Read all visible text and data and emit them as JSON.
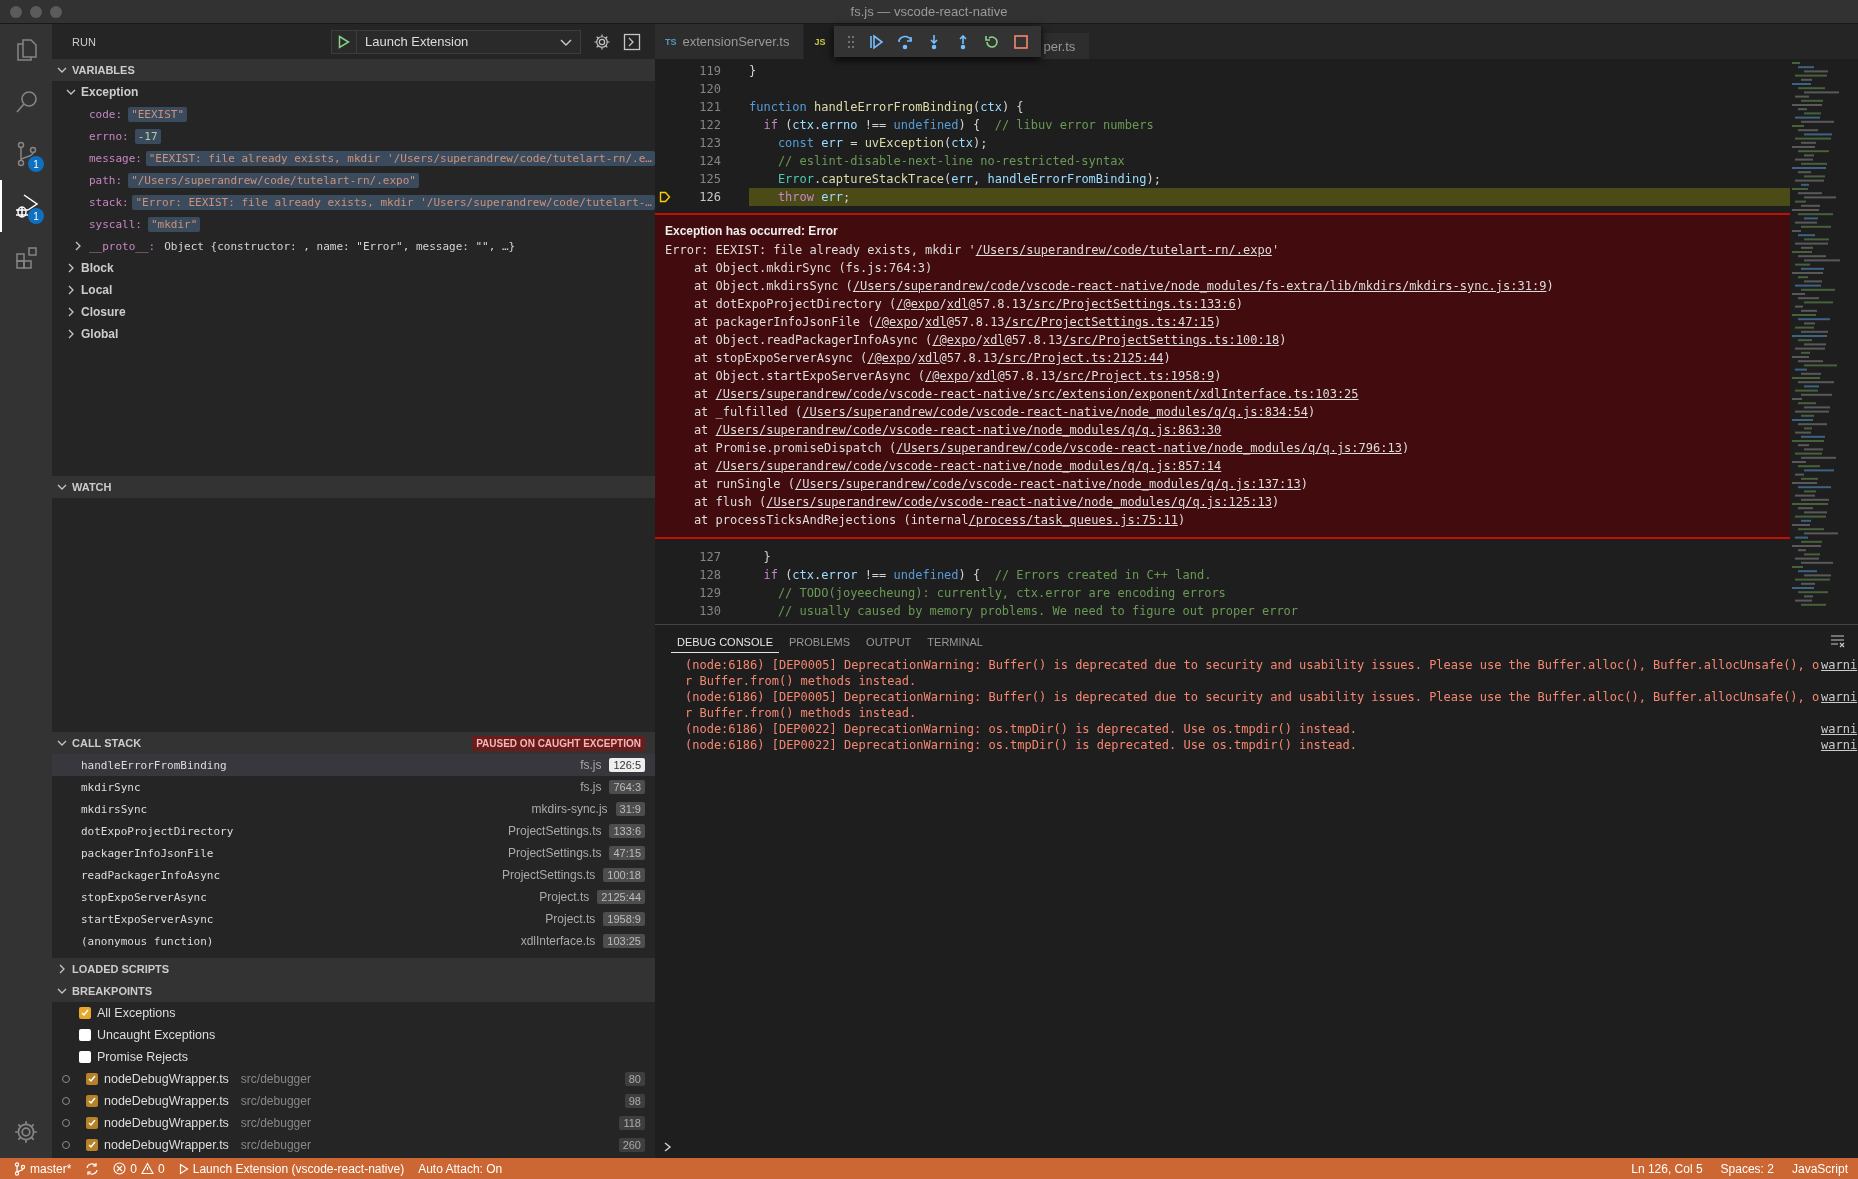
{
  "window": {
    "title": "fs.js — vscode-react-native"
  },
  "activity_bar": [
    {
      "kind": "explorer",
      "selected": false
    },
    {
      "kind": "search",
      "selected": false
    },
    {
      "kind": "source-control",
      "selected": false,
      "badge": "1"
    },
    {
      "kind": "debug",
      "selected": true,
      "badge": "1"
    },
    {
      "kind": "extensions",
      "selected": false
    }
  ],
  "sidebar": {
    "title": "RUN",
    "config": "Launch Extension"
  },
  "variables": {
    "title": "VARIABLES",
    "expanded": true,
    "scopes": [
      {
        "name": "Exception",
        "expanded": true,
        "children": [
          {
            "name": "code:",
            "value": "\"EEXIST\"",
            "kind": "string",
            "changed": true
          },
          {
            "name": "errno:",
            "value": "-17",
            "kind": "number",
            "changed": true
          },
          {
            "name": "message:",
            "value": "\"EEXIST: file already exists, mkdir '/Users/superandrew/code/tutelart-rn/.e…",
            "kind": "string",
            "changed": true
          },
          {
            "name": "path:",
            "value": "\"/Users/superandrew/code/tutelart-rn/.expo\"",
            "kind": "string",
            "changed": true
          },
          {
            "name": "stack:",
            "value": "\"Error: EEXIST: file already exists, mkdir '/Users/superandrew/code/tutelart-…",
            "kind": "string",
            "changed": true
          },
          {
            "name": "syscall:",
            "value": "\"mkdir\"",
            "kind": "string",
            "changed": true
          },
          {
            "name": "__proto__:",
            "value": "Object {constructor: , name: \"Error\", message: \"\", …}",
            "kind": "object",
            "changed": false,
            "expanded": false
          }
        ]
      },
      {
        "name": "Block",
        "expanded": false
      },
      {
        "name": "Local",
        "expanded": false
      },
      {
        "name": "Closure",
        "expanded": false
      },
      {
        "name": "Global",
        "expanded": false
      }
    ]
  },
  "watch": {
    "title": "WATCH",
    "expanded": true
  },
  "call_stack": {
    "title": "CALL STACK",
    "expanded": true,
    "status": "PAUSED ON CAUGHT EXCEPTION",
    "frames": [
      {
        "name": "handleErrorFromBinding",
        "file": "fs.js",
        "position": "126:5",
        "selected": true
      },
      {
        "name": "mkdirSync",
        "file": "fs.js",
        "position": "764:3",
        "selected": false
      },
      {
        "name": "mkdirsSync",
        "file": "mkdirs-sync.js",
        "position": "31:9",
        "selected": false
      },
      {
        "name": "dotExpoProjectDirectory",
        "file": "ProjectSettings.ts",
        "position": "133:6",
        "selected": false
      },
      {
        "name": "packagerInfoJsonFile",
        "file": "ProjectSettings.ts",
        "position": "47:15",
        "selected": false
      },
      {
        "name": "readPackagerInfoAsync",
        "file": "ProjectSettings.ts",
        "position": "100:18",
        "selected": false
      },
      {
        "name": "stopExpoServerAsync",
        "file": "Project.ts",
        "position": "2125:44",
        "selected": false
      },
      {
        "name": "startExpoServerAsync",
        "file": "Project.ts",
        "position": "1958:9",
        "selected": false
      },
      {
        "name": "(anonymous function)",
        "file": "xdlInterface.ts",
        "position": "103:25",
        "selected": false
      }
    ]
  },
  "loaded_scripts": {
    "title": "LOADED SCRIPTS",
    "expanded": false
  },
  "breakpoints": {
    "title": "BREAKPOINTS",
    "expanded": true,
    "items": [
      {
        "kind": "exception",
        "label": "All Exceptions",
        "checked": true
      },
      {
        "kind": "exception",
        "label": "Uncaught Exceptions",
        "checked": false
      },
      {
        "kind": "exception",
        "label": "Promise Rejects",
        "checked": false
      },
      {
        "kind": "file",
        "file": "nodeDebugWrapper.ts",
        "folder": "src/debugger",
        "line": "80",
        "checked": true
      },
      {
        "kind": "file",
        "file": "nodeDebugWrapper.ts",
        "folder": "src/debugger",
        "line": "98",
        "checked": true
      },
      {
        "kind": "file",
        "file": "nodeDebugWrapper.ts",
        "folder": "src/debugger",
        "line": "118",
        "checked": true
      },
      {
        "kind": "file",
        "file": "nodeDebugWrapper.ts",
        "folder": "src/debugger",
        "line": "260",
        "checked": true
      }
    ]
  },
  "editor": {
    "tabs": [
      {
        "badge": "TS",
        "color": "#519aba",
        "label": "extensionServer.ts",
        "selected": false
      },
      {
        "badge": "JS",
        "color": "#cbcb41",
        "selected": true
      },
      {
        "label": "per.ts",
        "selected": false
      }
    ],
    "debug_toolbar": [
      {
        "kind": "grip"
      },
      {
        "kind": "continue"
      },
      {
        "kind": "step-over"
      },
      {
        "kind": "step-into"
      },
      {
        "kind": "step-out"
      },
      {
        "kind": "restart"
      },
      {
        "kind": "stop"
      }
    ],
    "lines": [
      {
        "number": "119",
        "current": false,
        "tokens": [
          {
            "text": "}",
            "kind": "plain"
          }
        ]
      },
      {
        "number": "120",
        "current": false
      },
      {
        "number": "121",
        "current": false,
        "tokens": [
          {
            "text": "function ",
            "kind": "keyword"
          },
          {
            "text": "handleErrorFromBinding",
            "kind": "function"
          },
          {
            "text": "(",
            "kind": "plain"
          },
          {
            "text": "ctx",
            "kind": "variable"
          },
          {
            "text": ") {",
            "kind": "plain"
          }
        ]
      },
      {
        "number": "122",
        "current": false,
        "tokens": [
          {
            "text": "  if",
            "kind": "control"
          },
          {
            "text": " (",
            "kind": "plain"
          },
          {
            "text": "ctx",
            "kind": "variable"
          },
          {
            "text": ".",
            "kind": "plain"
          },
          {
            "text": "errno",
            "kind": "variable"
          },
          {
            "text": " !== ",
            "kind": "plain"
          },
          {
            "text": "undefined",
            "kind": "keyword"
          },
          {
            "text": ") {  ",
            "kind": "plain"
          },
          {
            "text": "// libuv error numbers",
            "kind": "comment"
          }
        ]
      },
      {
        "number": "123",
        "current": false,
        "tokens": [
          {
            "text": "    const ",
            "kind": "keyword"
          },
          {
            "text": "err",
            "kind": "variable"
          },
          {
            "text": " = ",
            "kind": "plain"
          },
          {
            "text": "uvException",
            "kind": "function"
          },
          {
            "text": "(",
            "kind": "plain"
          },
          {
            "text": "ctx",
            "kind": "variable"
          },
          {
            "text": ");",
            "kind": "plain"
          }
        ]
      },
      {
        "number": "124",
        "current": false,
        "tokens": [
          {
            "text": "    // eslint-disable-next-line no-restricted-syntax",
            "kind": "comment"
          }
        ]
      },
      {
        "number": "125",
        "current": false,
        "tokens": [
          {
            "text": "    Error",
            "kind": "type"
          },
          {
            "text": ".",
            "kind": "plain"
          },
          {
            "text": "captureStackTrace",
            "kind": "function"
          },
          {
            "text": "(",
            "kind": "plain"
          },
          {
            "text": "err",
            "kind": "variable"
          },
          {
            "text": ", ",
            "kind": "plain"
          },
          {
            "text": "handleErrorFromBinding",
            "kind": "variable"
          },
          {
            "text": ");",
            "kind": "plain"
          }
        ]
      },
      {
        "number": "126",
        "current": true,
        "tokens": [
          {
            "text": "    throw ",
            "kind": "control"
          },
          {
            "text": "err",
            "kind": "variable"
          },
          {
            "text": ";",
            "kind": "plain"
          }
        ]
      }
    ],
    "exception": {
      "title": "Exception has occurred: Error",
      "lines": [
        [
          {
            "text": "Error: EEXIST: file already exists, mkdir '"
          },
          {
            "text": "/Users/superandrew/code/tutelart-rn/.expo",
            "link": true
          },
          {
            "text": "'"
          }
        ],
        [
          {
            "text": "    at Object.mkdirSync (fs.js:764:3)"
          }
        ],
        [
          {
            "text": "    at Object.mkdirsSync ("
          },
          {
            "text": "/Users/superandrew/code/vscode-react-native/node_modules/fs-extra/lib/mkdirs/mkdirs-sync.js:31:9",
            "link": true
          },
          {
            "text": ")"
          }
        ],
        [
          {
            "text": "    at dotExpoProjectDirectory ("
          },
          {
            "text": "/@expo",
            "link": true
          },
          {
            "text": "/"
          },
          {
            "text": "xdl",
            "link": true
          },
          {
            "text": "@57.8.13"
          },
          {
            "text": "/src/ProjectSettings.ts:133:6",
            "link": true
          },
          {
            "text": ")"
          }
        ],
        [
          {
            "text": "    at packagerInfoJsonFile ("
          },
          {
            "text": "/@expo",
            "link": true
          },
          {
            "text": "/"
          },
          {
            "text": "xdl",
            "link": true
          },
          {
            "text": "@57.8.13"
          },
          {
            "text": "/src/ProjectSettings.ts:47:15",
            "link": true
          },
          {
            "text": ")"
          }
        ],
        [
          {
            "text": "    at Object.readPackagerInfoAsync ("
          },
          {
            "text": "/@expo",
            "link": true
          },
          {
            "text": "/"
          },
          {
            "text": "xdl",
            "link": true
          },
          {
            "text": "@57.8.13"
          },
          {
            "text": "/src/ProjectSettings.ts:100:18",
            "link": true
          },
          {
            "text": ")"
          }
        ],
        [
          {
            "text": "    at stopExpoServerAsync ("
          },
          {
            "text": "/@expo",
            "link": true
          },
          {
            "text": "/"
          },
          {
            "text": "xdl",
            "link": true
          },
          {
            "text": "@57.8.13"
          },
          {
            "text": "/src/Project.ts:2125:44",
            "link": true
          },
          {
            "text": ")"
          }
        ],
        [
          {
            "text": "    at Object.startExpoServerAsync ("
          },
          {
            "text": "/@expo",
            "link": true
          },
          {
            "text": "/"
          },
          {
            "text": "xdl",
            "link": true
          },
          {
            "text": "@57.8.13"
          },
          {
            "text": "/src/Project.ts:1958:9",
            "link": true
          },
          {
            "text": ")"
          }
        ],
        [
          {
            "text": "    at "
          },
          {
            "text": "/Users/superandrew/code/vscode-react-native/src/extension/exponent/xdlInterface.ts:103:25",
            "link": true
          }
        ],
        [
          {
            "text": "    at _fulfilled ("
          },
          {
            "text": "/Users/superandrew/code/vscode-react-native/node_modules/q/q.js:834:54",
            "link": true
          },
          {
            "text": ")"
          }
        ],
        [
          {
            "text": "    at "
          },
          {
            "text": "/Users/superandrew/code/vscode-react-native/node_modules/q/q.js:863:30",
            "link": true
          }
        ],
        [
          {
            "text": "    at Promise.promiseDispatch ("
          },
          {
            "text": "/Users/superandrew/code/vscode-react-native/node_modules/q/q.js:796:13",
            "link": true
          },
          {
            "text": ")"
          }
        ],
        [
          {
            "text": "    at "
          },
          {
            "text": "/Users/superandrew/code/vscode-react-native/node_modules/q/q.js:857:14",
            "link": true
          }
        ],
        [
          {
            "text": "    at runSingle ("
          },
          {
            "text": "/Users/superandrew/code/vscode-react-native/node_modules/q/q.js:137:13",
            "link": true
          },
          {
            "text": ")"
          }
        ],
        [
          {
            "text": "    at flush ("
          },
          {
            "text": "/Users/superandrew/code/vscode-react-native/node_modules/q/q.js:125:13",
            "link": true
          },
          {
            "text": ")"
          }
        ],
        [
          {
            "text": "    at processTicksAndRejections (internal"
          },
          {
            "text": "/process/task_queues.js:75:11",
            "link": true
          },
          {
            "text": ")"
          }
        ]
      ]
    },
    "lines_after": [
      {
        "number": "127",
        "current": false,
        "tokens": [
          {
            "text": "  }",
            "kind": "plain"
          }
        ]
      },
      {
        "number": "128",
        "current": false,
        "tokens": [
          {
            "text": "  if",
            "kind": "control"
          },
          {
            "text": " (",
            "kind": "plain"
          },
          {
            "text": "ctx",
            "kind": "variable"
          },
          {
            "text": ".",
            "kind": "plain"
          },
          {
            "text": "error",
            "kind": "variable"
          },
          {
            "text": " !== ",
            "kind": "plain"
          },
          {
            "text": "undefined",
            "kind": "keyword"
          },
          {
            "text": ") {  ",
            "kind": "plain"
          },
          {
            "text": "// Errors created in C++ land.",
            "kind": "comment"
          }
        ]
      },
      {
        "number": "129",
        "current": false,
        "tokens": [
          {
            "text": "    // TODO(joyeecheung): currently, ctx.error are encoding errors",
            "kind": "comment"
          }
        ]
      },
      {
        "number": "130",
        "current": false,
        "tokens": [
          {
            "text": "    // usually caused by memory problems. We need to figure out proper error",
            "kind": "comment"
          }
        ]
      }
    ]
  },
  "panel": {
    "tabs": [
      {
        "label": "DEBUG CONSOLE",
        "selected": true
      },
      {
        "label": "PROBLEMS",
        "selected": false
      },
      {
        "label": "OUTPUT",
        "selected": false
      },
      {
        "label": "TERMINAL",
        "selected": false
      }
    ],
    "messages": [
      {
        "lines": [
          "(node:6186) [DEP0005] DeprecationWarning: Buffer() is deprecated due to security and usability issues. Please use the Buffer.alloc(), Buffer.allocUnsafe(), o",
          "r Buffer.from() methods instead."
        ],
        "link": "warni"
      },
      {
        "lines": [
          "(node:6186) [DEP0005] DeprecationWarning: Buffer() is deprecated due to security and usability issues. Please use the Buffer.alloc(), Buffer.allocUnsafe(), o",
          "r Buffer.from() methods instead."
        ],
        "link": "warni"
      },
      {
        "lines": [
          "(node:6186) [DEP0022] DeprecationWarning: os.tmpDir() is deprecated. Use os.tmpdir() instead."
        ],
        "link": "warni"
      },
      {
        "lines": [
          "(node:6186) [DEP0022] DeprecationWarning: os.tmpDir() is deprecated. Use os.tmpdir() instead."
        ],
        "link": "warni"
      }
    ]
  },
  "status_bar": {
    "branch": "master*",
    "errors": "0",
    "warnings": "0",
    "launch": "Launch Extension (vscode-react-native)",
    "auto_attach": "Auto Attach: On",
    "position": "Ln 126, Col 5",
    "spaces": "Spaces: 2",
    "language": "JavaScript"
  }
}
